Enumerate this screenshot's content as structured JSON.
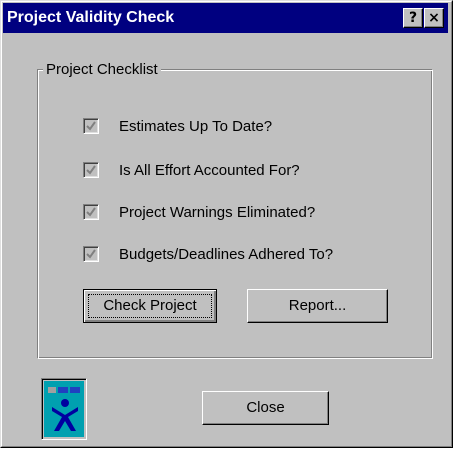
{
  "window": {
    "title": "Project Validity Check",
    "help_button": "?",
    "close_button": "×"
  },
  "checklist": {
    "group_title": "Project Checklist",
    "items": [
      {
        "label": "Estimates Up To Date?",
        "checked": true,
        "enabled": false
      },
      {
        "label": "Is All Effort Accounted For?",
        "checked": true,
        "enabled": false
      },
      {
        "label": "Project Warnings Eliminated?",
        "checked": true,
        "enabled": false
      },
      {
        "label": "Budgets/Deadlines Adhered To?",
        "checked": true,
        "enabled": false
      }
    ]
  },
  "buttons": {
    "check_project": "Check Project",
    "report": "Report...",
    "close": "Close"
  },
  "icons": {
    "app_icon": "person-project-icon"
  },
  "colors": {
    "titlebar": "#000080",
    "face": "#c0c0c0",
    "disabled_check": "#808080"
  }
}
